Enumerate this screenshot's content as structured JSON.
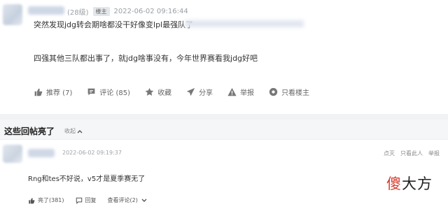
{
  "post": {
    "level": "(28级)",
    "badge": "楼主",
    "timestamp": "2022-06-02 09:16:44",
    "line1": "突然发现jdg转会期啥都没干好像变lpl最强队了",
    "line2": "四强其他三队都出事了，就jdg啥事没有，今年世界赛看我jdg好吧",
    "actions": [
      {
        "icon": "thumb-up-icon",
        "label": "推荐 (7)"
      },
      {
        "icon": "comment-icon",
        "label": "评论 (85)"
      },
      {
        "icon": "star-icon",
        "label": "收藏"
      },
      {
        "icon": "share-icon",
        "label": "分享"
      },
      {
        "icon": "warning-icon",
        "label": "举报"
      },
      {
        "icon": "eye-icon",
        "label": "只看楼主"
      }
    ]
  },
  "section": {
    "title": "这些回帖亮了",
    "collapse_label": "收起"
  },
  "comment": {
    "timestamp": "2022-06-02 09:19:37",
    "right_actions": [
      "点灭",
      "只看此人",
      "举报"
    ],
    "text": "Rng和tes不好说，v5才是夏季赛无了",
    "actions": [
      {
        "icon": "thumb-up-icon",
        "label": "亮了(381)"
      },
      {
        "icon": "reply-icon",
        "label": "回复"
      },
      {
        "icon": "comment-icon",
        "label": "查看评论(2)"
      }
    ]
  },
  "watermark": {
    "first": "傻",
    "rest": "大方"
  }
}
